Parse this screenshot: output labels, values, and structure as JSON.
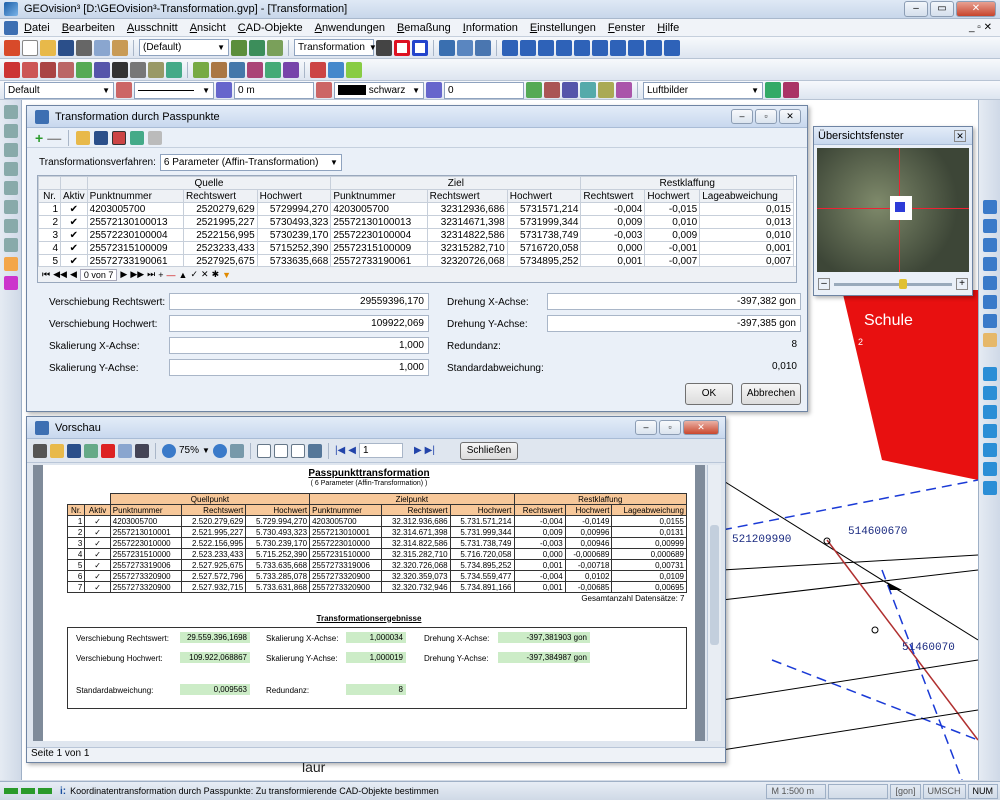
{
  "app": {
    "title": "GEOvision³  [D:\\GEOvision³-Transformation.gvp] - [Transformation]"
  },
  "menu": [
    "Datei",
    "Bearbeiten",
    "Ausschnitt",
    "Ansicht",
    "CAD-Objekte",
    "Anwendungen",
    "Bemaßung",
    "Information",
    "Einstellungen",
    "Fenster",
    "Hilfe"
  ],
  "toolbar": {
    "layer_combo": "(Default)",
    "transform_combo": "Transformation",
    "style_combo": "Default",
    "width_value": "0 m",
    "color_value": "schwarz",
    "linewidth_value": "0",
    "layer_raster": "Luftbilder"
  },
  "dialog": {
    "title": "Transformation durch Passpunkte",
    "method_label": "Transformationsverfahren:",
    "method_value": "6 Parameter (Affin-Transformation)",
    "groups": {
      "quelle": "Quelle",
      "ziel": "Ziel",
      "rest": "Restklaffung"
    },
    "columns": [
      "Nr.",
      "Aktiv",
      "Punktnummer",
      "Rechtswert",
      "Hochwert",
      "Punktnummer",
      "Rechtswert",
      "Hochwert",
      "Rechtswert",
      "Hochwert",
      "Lageabweichung"
    ],
    "rows": [
      {
        "nr": "1",
        "aktiv": "✔",
        "qp": "4203005700",
        "qr": "2520279,629",
        "qh": "5729994,270",
        "zp": "4203005700",
        "zr": "32312936,686",
        "zh": "5731571,214",
        "rr": "-0,004",
        "rh": "-0,015",
        "la": "0,015"
      },
      {
        "nr": "2",
        "aktiv": "✔",
        "qp": "25572130100013",
        "qr": "2521995,227",
        "qh": "5730493,323",
        "zp": "25572130100013",
        "zr": "32314671,398",
        "zh": "5731999,344",
        "rr": "0,009",
        "rh": "0,010",
        "la": "0,013"
      },
      {
        "nr": "3",
        "aktiv": "✔",
        "qp": "25572230100004",
        "qr": "2522156,995",
        "qh": "5730239,170",
        "zp": "25572230100004",
        "zr": "32314822,586",
        "zh": "5731738,749",
        "rr": "-0,003",
        "rh": "0,009",
        "la": "0,010"
      },
      {
        "nr": "4",
        "aktiv": "✔",
        "qp": "25572315100009",
        "qr": "2523233,433",
        "qh": "5715252,390",
        "zp": "25572315100009",
        "zr": "32315282,710",
        "zh": "5716720,058",
        "rr": "0,000",
        "rh": "-0,001",
        "la": "0,001"
      },
      {
        "nr": "5",
        "aktiv": "✔",
        "qp": "25572733190061",
        "qr": "2527925,675",
        "qh": "5733635,668",
        "zp": "25572733190061",
        "zr": "32320726,068",
        "zh": "5734895,252",
        "rr": "0,001",
        "rh": "-0,007",
        "la": "0,007"
      }
    ],
    "nav_count": "0 von 7",
    "fields": {
      "vr_label": "Verschiebung Rechtswert:",
      "vr": "29559396,170",
      "vh_label": "Verschiebung Hochwert:",
      "vh": "109922,069",
      "sx_label": "Skalierung X-Achse:",
      "sx": "1,000",
      "sy_label": "Skalierung Y-Achse:",
      "sy": "1,000",
      "dx_label": "Drehung X-Achse:",
      "dx": "-397,382 gon",
      "dy_label": "Drehung Y-Achse:",
      "dy": "-397,385 gon",
      "red_label": "Redundanz:",
      "red": "8",
      "std_label": "Standardabweichung:",
      "std": "0,010"
    },
    "ok": "OK",
    "cancel": "Abbrechen"
  },
  "overview": {
    "title": "Übersichtsfenster"
  },
  "preview": {
    "title": "Vorschau",
    "zoom": "75%",
    "page_input": "1",
    "close_btn": "Schließen",
    "report_title": "Passpunkttransformation",
    "report_subtitle": "( 6 Parameter (Affin-Transformation) )",
    "groups": {
      "q": "Quellpunkt",
      "z": "Zielpunkt",
      "r": "Restklaffung"
    },
    "columns": [
      "Nr.",
      "Aktiv",
      "Punktnummer",
      "Rechtswert",
      "Hochwert",
      "Punktnummer",
      "Rechtswert",
      "Hochwert",
      "Rechtswert",
      "Hochwert",
      "Lageabweichung"
    ],
    "rows": [
      {
        "nr": "1",
        "a": "✓",
        "qp": "4203005700",
        "qr": "2.520.279,629",
        "qh": "5.729.994,270",
        "zp": "4203005700",
        "zr": "32.312.936,686",
        "zh": "5.731.571,214",
        "rr": "-0,004",
        "rh": "-0,0149",
        "la": "0,0155"
      },
      {
        "nr": "2",
        "a": "✓",
        "qp": "2557213010001",
        "qr": "2.521.995,227",
        "qh": "5.730.493,323",
        "zp": "2557213010001",
        "zr": "32.314.671,398",
        "zh": "5.731.999,344",
        "rr": "0,009",
        "rh": "0,00996",
        "la": "0,0131"
      },
      {
        "nr": "3",
        "a": "✓",
        "qp": "2557223010000",
        "qr": "2.522.156,995",
        "qh": "5.730.239,170",
        "zp": "2557223010000",
        "zr": "32.314.822,586",
        "zh": "5.731.738,749",
        "rr": "-0,003",
        "rh": "0,00946",
        "la": "0,00999"
      },
      {
        "nr": "4",
        "a": "✓",
        "qp": "2557231510000",
        "qr": "2.523.233,433",
        "qh": "5.715.252,390",
        "zp": "2557231510000",
        "zr": "32.315.282,710",
        "zh": "5.716.720,058",
        "rr": "0,000",
        "rh": "-0,000689",
        "la": "0,000689"
      },
      {
        "nr": "5",
        "a": "✓",
        "qp": "2557273319006",
        "qr": "2.527.925,675",
        "qh": "5.733.635,668",
        "zp": "2557273319006",
        "zr": "32.320.726,068",
        "zh": "5.734.895,252",
        "rr": "0,001",
        "rh": "-0,00718",
        "la": "0,00731"
      },
      {
        "nr": "6",
        "a": "✓",
        "qp": "2557273320900",
        "qr": "2.527.572,796",
        "qh": "5.733.285,078",
        "zp": "2557273320900",
        "zr": "32.320.359,073",
        "zh": "5.734.559,477",
        "rr": "-0,004",
        "rh": "0,0102",
        "la": "0,0109"
      },
      {
        "nr": "7",
        "a": "✓",
        "qp": "2557273320900",
        "qr": "2.527.932,715",
        "qh": "5.733.631,868",
        "zp": "2557273320900",
        "zr": "32.320.732,946",
        "zh": "5.734.891,166",
        "rr": "0,001",
        "rh": "-0,00685",
        "la": "0,00695"
      }
    ],
    "total": "Gesamtanzahl Datensätze: 7",
    "results_title": "Transformationsergebnisse",
    "res": {
      "vr_l": "Verschiebung Rechtswert:",
      "vr": "29.559.396,1698",
      "vh_l": "Verschiebung Hochwert:",
      "vh": "109.922,068867",
      "sx_l": "Skalierung X-Achse:",
      "sx": "1,000034",
      "sy_l": "Skalierung Y-Achse:",
      "sy": "1,000019",
      "dx_l": "Drehung X-Achse:",
      "dx": "-397,381903 gon",
      "dy_l": "Drehung Y-Achse:",
      "dy": "-397,384987 gon",
      "std_l": "Standardabweichung:",
      "std": "0,009563",
      "red_l": "Redundanz:",
      "red": "8"
    },
    "page_status": "Seite 1 von 1"
  },
  "cad": {
    "school_label": "Schule",
    "small_label": "2",
    "point_a": "514600670",
    "point_b": "521209990",
    "point_c": "51460070",
    "street_text": "laur"
  },
  "status": {
    "message": "Koordinatentransformation durch Passpunkte: Zu transformierende CAD-Objekte bestimmen",
    "scale": "M 1:500  m",
    "unit": "[gon]",
    "umsch": "UMSCH",
    "num": "NUM"
  }
}
